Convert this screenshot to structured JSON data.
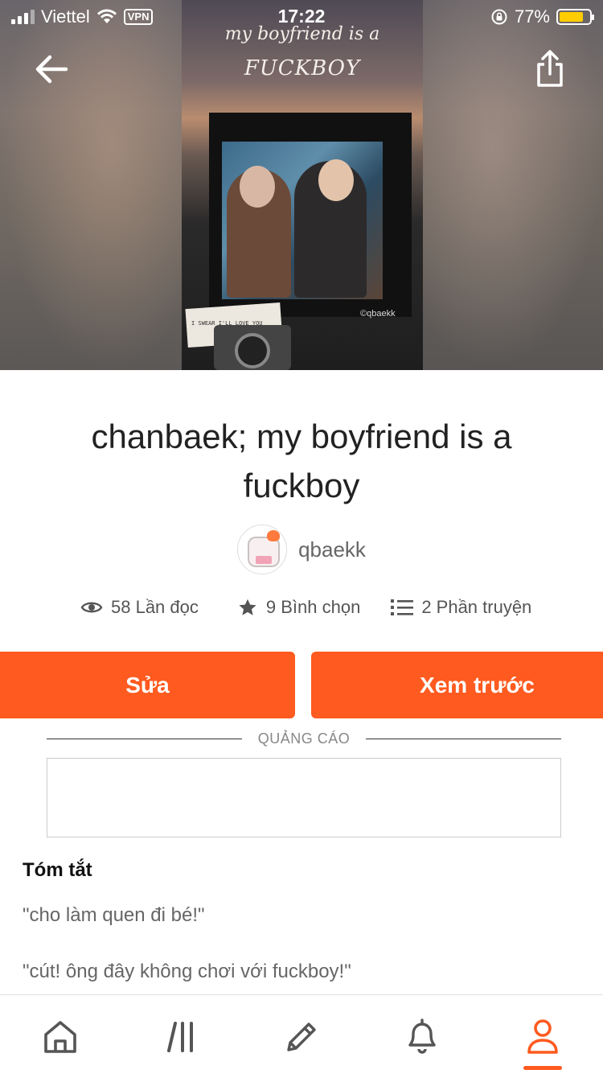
{
  "status_bar": {
    "carrier": "Viettel",
    "vpn": "VPN",
    "time": "17:22",
    "battery_percent": "77%",
    "battery_level": 0.77
  },
  "cover": {
    "line1": "my boyfriend is a",
    "line2": "FUCKBOY",
    "credit": "©qbaekk",
    "note_lines": [
      "I SWEAR I'LL LOVE YOU"
    ]
  },
  "story": {
    "title": "chanbaek; my boyfriend is a fuckboy",
    "author": "qbaekk",
    "stats": {
      "reads": "58 Lần đọc",
      "votes": "9 Bình chọn",
      "parts": "2 Phần truyện"
    }
  },
  "actions": {
    "edit_label": "Sửa",
    "preview_label": "Xem trước"
  },
  "ad": {
    "label": "QUẢNG CÁO"
  },
  "summary": {
    "heading": "Tóm tắt",
    "lines": [
      "\"cho làm quen đi bé!\"",
      "\"cút! ông đây không chơi với fuckboy!\""
    ]
  },
  "icons": {
    "back": "arrow-left-icon",
    "share": "share-icon",
    "reads": "eye-icon",
    "votes": "star-icon",
    "parts": "list-icon",
    "nav": [
      "home-icon",
      "library-icon",
      "pencil-icon",
      "bell-icon",
      "person-icon"
    ]
  },
  "colors": {
    "accent": "#ff5a1f",
    "battery": "#ffcc00"
  }
}
